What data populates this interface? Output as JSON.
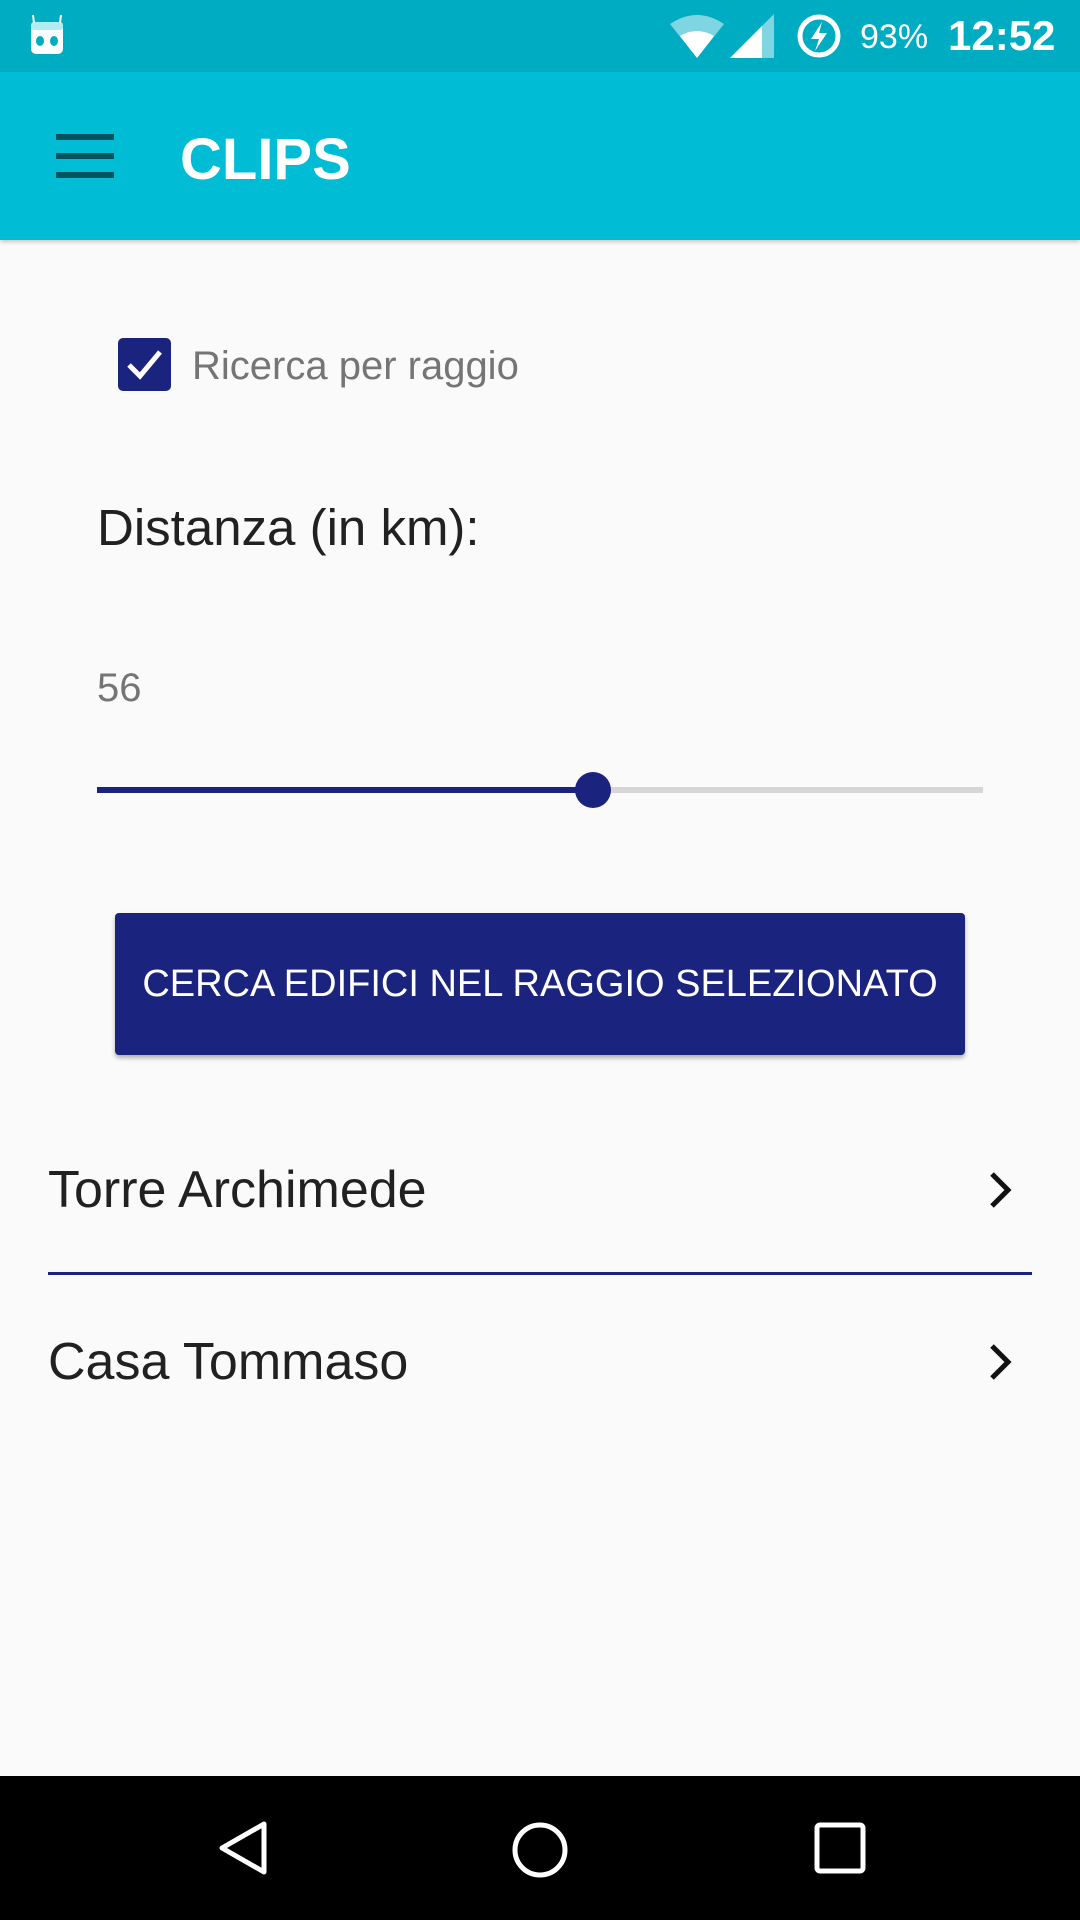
{
  "status_bar": {
    "battery": "93%",
    "time": "12:52"
  },
  "app_bar": {
    "title": "CLIPS"
  },
  "form": {
    "checkbox_label": "Ricerca per raggio",
    "checkbox_checked": true,
    "distance_label": "Distanza (in km):",
    "distance_value": "56",
    "slider": {
      "value": 56,
      "min": 0,
      "max": 100
    },
    "search_button": "CERCA EDIFICI NEL RAGGIO SELEZIONATO"
  },
  "results": [
    {
      "name": "Torre Archimede"
    },
    {
      "name": "Casa Tommaso"
    }
  ],
  "colors": {
    "primary": "#00bcd4",
    "status": "#00acc1",
    "accent": "#1a237e"
  }
}
